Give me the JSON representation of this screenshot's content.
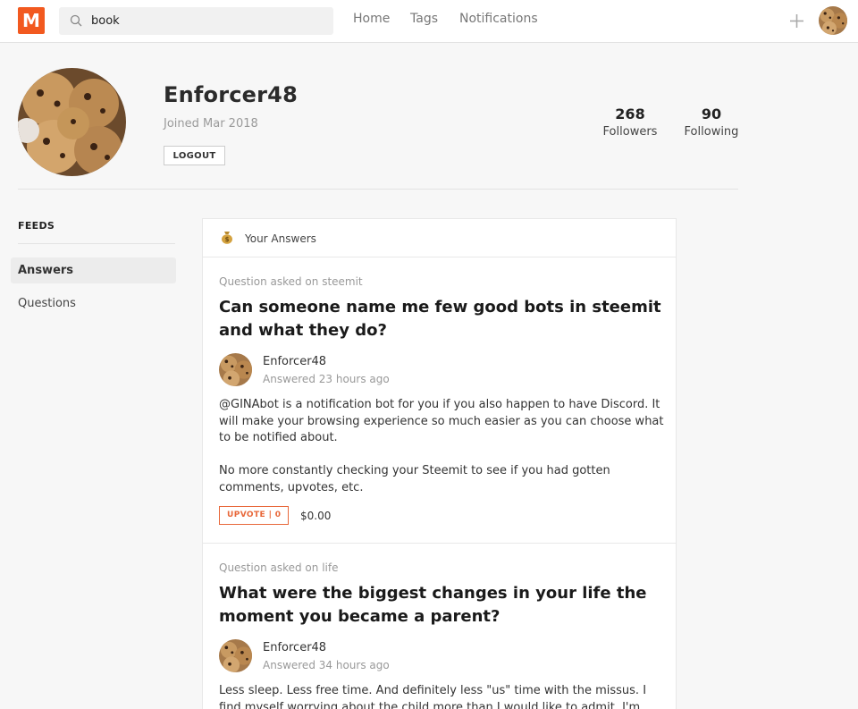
{
  "header": {
    "logo_text": "M",
    "search_value": "book",
    "nav": [
      "Home",
      "Tags",
      "Notifications"
    ]
  },
  "profile": {
    "username": "Enforcer48",
    "joined": "Joined Mar 2018",
    "logout_label": "LOGOUT",
    "followers_count": "268",
    "followers_label": "Followers",
    "following_count": "90",
    "following_label": "Following"
  },
  "sidebar": {
    "title": "FEEDS",
    "items": [
      {
        "label": "Answers",
        "active": true
      },
      {
        "label": "Questions",
        "active": false
      }
    ]
  },
  "feed": {
    "title": "Your Answers",
    "answers": [
      {
        "asked_on": "Question asked on steemit",
        "question": "Can someone name me few good bots in steemit and what they do?",
        "author": "Enforcer48",
        "time": "Answered 23 hours ago",
        "paragraphs": [
          "@GINAbot is a notification bot for you if you also happen to have Discord. It will make your browsing experience so much easier as you can choose what to be notified about.",
          "No more constantly checking your Steemit to see if you had gotten comments, upvotes, etc."
        ],
        "upvote_label": "UPVOTE | 0",
        "payout": "$0.00"
      },
      {
        "asked_on": "Question asked on life",
        "question": "What were the biggest changes in your life the moment you became a parent?",
        "author": "Enforcer48",
        "time": "Answered 34 hours ago",
        "paragraphs": [
          "Less sleep. Less free time. And definitely less \"us\" time with the missus. I find myself worrying about the child more than I would like to admit. I'm always"
        ]
      }
    ]
  },
  "colors": {
    "brand": "#f2591f",
    "upvote": "#e8683a"
  },
  "icons": [
    "search-icon",
    "plus-icon",
    "money-bag-icon"
  ]
}
